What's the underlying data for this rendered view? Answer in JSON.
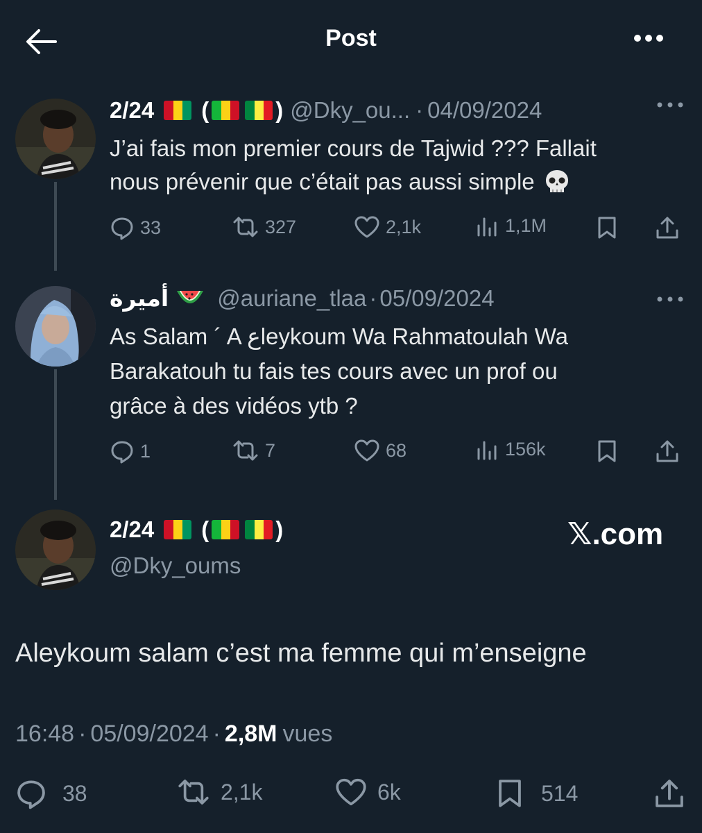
{
  "header": {
    "title": "Post"
  },
  "tweet1": {
    "name": "2/24",
    "paren_open": "(",
    "paren_close": ")",
    "handle": "@Dky_ou...",
    "sep": "·",
    "date": "04/09/2024",
    "text_line1": "J’ai fais mon premier cours de Tajwid ??? Fallait",
    "text_line2": "nous prévenir que c’était pas aussi simple",
    "emoji": "💀",
    "counts": {
      "replies": "33",
      "retweets": "327",
      "likes": "2,1k",
      "views": "1,1M"
    }
  },
  "tweet2": {
    "name": "أميرة",
    "emoji": "🍉",
    "handle": "@auriane_tlaa",
    "sep": "·",
    "date": "05/09/2024",
    "text_line1": "As Salam ´ A عleykoum Wa Rahmatoulah Wa",
    "text_line2": "Barakatouh tu fais tes cours avec un prof ou",
    "text_line3": "grâce à des vidéos ytb ?",
    "counts": {
      "replies": "1",
      "retweets": "7",
      "likes": "68",
      "views": "156k"
    }
  },
  "main_tweet": {
    "name": "2/24",
    "paren_open": "(",
    "paren_close": ")",
    "handle": "@Dky_oums",
    "watermark": "𝕏.com",
    "text": "Aleykoum salam c’est ma femme qui m’enseigne",
    "time": "16:48",
    "sep": "·",
    "date": "05/09/2024",
    "views_count": "2,8M",
    "views_label": "vues",
    "counts": {
      "replies": "38",
      "retweets": "2,1k",
      "likes": "6k",
      "bookmarks": "514"
    }
  },
  "icons": [
    "back-arrow-icon",
    "more-icon",
    "reply-icon",
    "retweet-icon",
    "like-icon",
    "views-icon",
    "bookmark-icon",
    "share-icon",
    "skull-icon",
    "watermelon-icon"
  ],
  "colors": {
    "background": "#15202b",
    "text": "#e7e9ea",
    "muted": "#8b98a5",
    "thread_line": "#3e4a54"
  }
}
